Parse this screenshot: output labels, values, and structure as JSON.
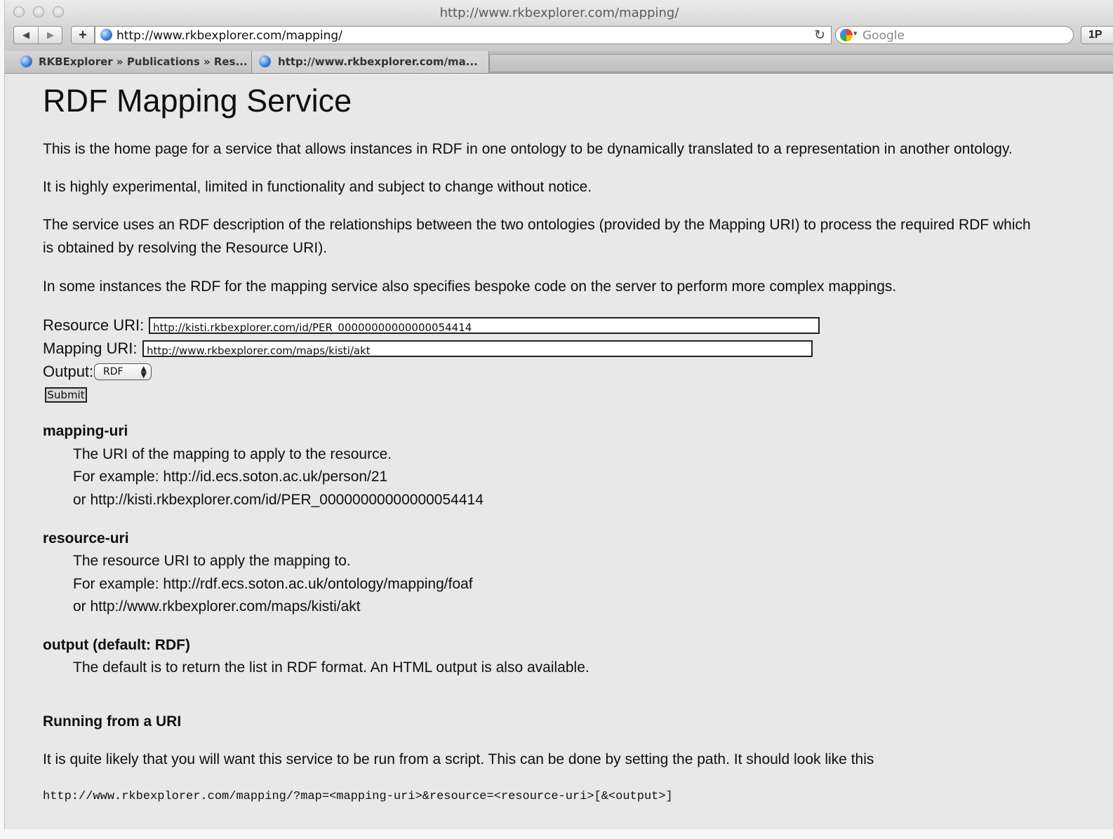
{
  "window": {
    "title": "http://www.rkbexplorer.com/mapping/"
  },
  "toolbar": {
    "back_glyph": "◀",
    "forward_glyph": "▶",
    "add_glyph": "+",
    "url": "http://www.rkbexplorer.com/mapping/",
    "reload_glyph": "↻",
    "search_placeholder": "Google",
    "onepassword_label": "1P"
  },
  "tabs": [
    {
      "label": "RKBExplorer » Publications » Res...",
      "active": false
    },
    {
      "label": "http://www.rkbexplorer.com/ma...",
      "active": true
    }
  ],
  "page": {
    "heading": "RDF Mapping Service",
    "paragraphs": [
      "This is the home page for a service that allows instances in RDF in one ontology to be dynamically translated to a representation in another ontology.",
      "It is highly experimental, limited in functionality and subject to change without notice.",
      "The service uses an RDF description of the relationships between the two ontologies (provided by the Mapping URI) to process the required RDF which",
      "is obtained by resolving the Resource URI).",
      "In some instances the RDF for the mapping service also specifies bespoke code on the server to perform more complex mappings."
    ],
    "form": {
      "resource_label": "Resource URI:",
      "resource_value": "http://kisti.rkbexplorer.com/id/PER_00000000000000054414",
      "mapping_label": "Mapping URI:",
      "mapping_value": "http://www.rkbexplorer.com/maps/kisti/akt",
      "output_label": "Output:",
      "output_selected": "RDF",
      "submit_label": "Submit"
    },
    "definitions": [
      {
        "term": "mapping-uri",
        "lines": [
          "The URI of the mapping to apply to the resource.",
          "For example: http://id.ecs.soton.ac.uk/person/21",
          "or http://kisti.rkbexplorer.com/id/PER_00000000000000054414"
        ]
      },
      {
        "term": "resource-uri",
        "lines": [
          "The resource URI to apply the mapping to.",
          "For example: http://rdf.ecs.soton.ac.uk/ontology/mapping/foaf",
          "or http://www.rkbexplorer.com/maps/kisti/akt"
        ]
      },
      {
        "term": "output (default: RDF)",
        "lines": [
          "The default is to return the list in RDF format. An HTML output is also available."
        ]
      }
    ],
    "running_heading": "Running from a URI",
    "running_text": "It is quite likely that you will want this service to be run from a script. This can be done by setting the path. It should look like this",
    "code": "http://www.rkbexplorer.com/mapping/?map=<mapping-uri>&resource=<resource-uri>[&<output>]"
  }
}
